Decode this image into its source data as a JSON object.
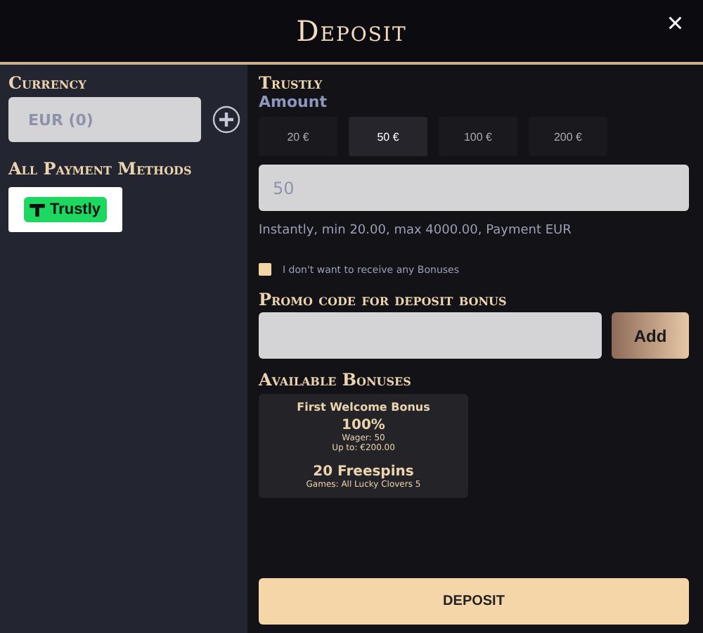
{
  "window": {
    "title": "Deposit",
    "close": "×"
  },
  "sidebar": {
    "currency_label": "Currency",
    "currency_value": "EUR (0)",
    "methods_label": "All Payment Methods",
    "methods": [
      {
        "label": "Trustly",
        "selected": true
      }
    ]
  },
  "method_title": "Trustly",
  "amount_label": "Amount",
  "amount_options": [
    {
      "label": "20 €",
      "selected": false
    },
    {
      "label": "50 €",
      "selected": true
    },
    {
      "label": "100 €",
      "selected": false
    },
    {
      "label": "200 €",
      "selected": false
    }
  ],
  "amount_value": "50",
  "info": "Instantly, min 20.00, max 4000.00, Payment EUR",
  "no_bonus": {
    "label": "I don't want to receive any Bonuses",
    "checked": false
  },
  "promo_label": "Promo code for deposit bonus",
  "add_button": "Add",
  "bonuses_label": "Available Bonuses",
  "bonuses": [
    {
      "title": "First Welcome Bonus",
      "percent": "100%",
      "wager": "Wager: 50",
      "up_to": "Up to: €200.00",
      "freespins": "20 Freespins",
      "games": "Games: All Lucky Clovers 5"
    }
  ],
  "deposit_button": "DEPOSIT"
}
